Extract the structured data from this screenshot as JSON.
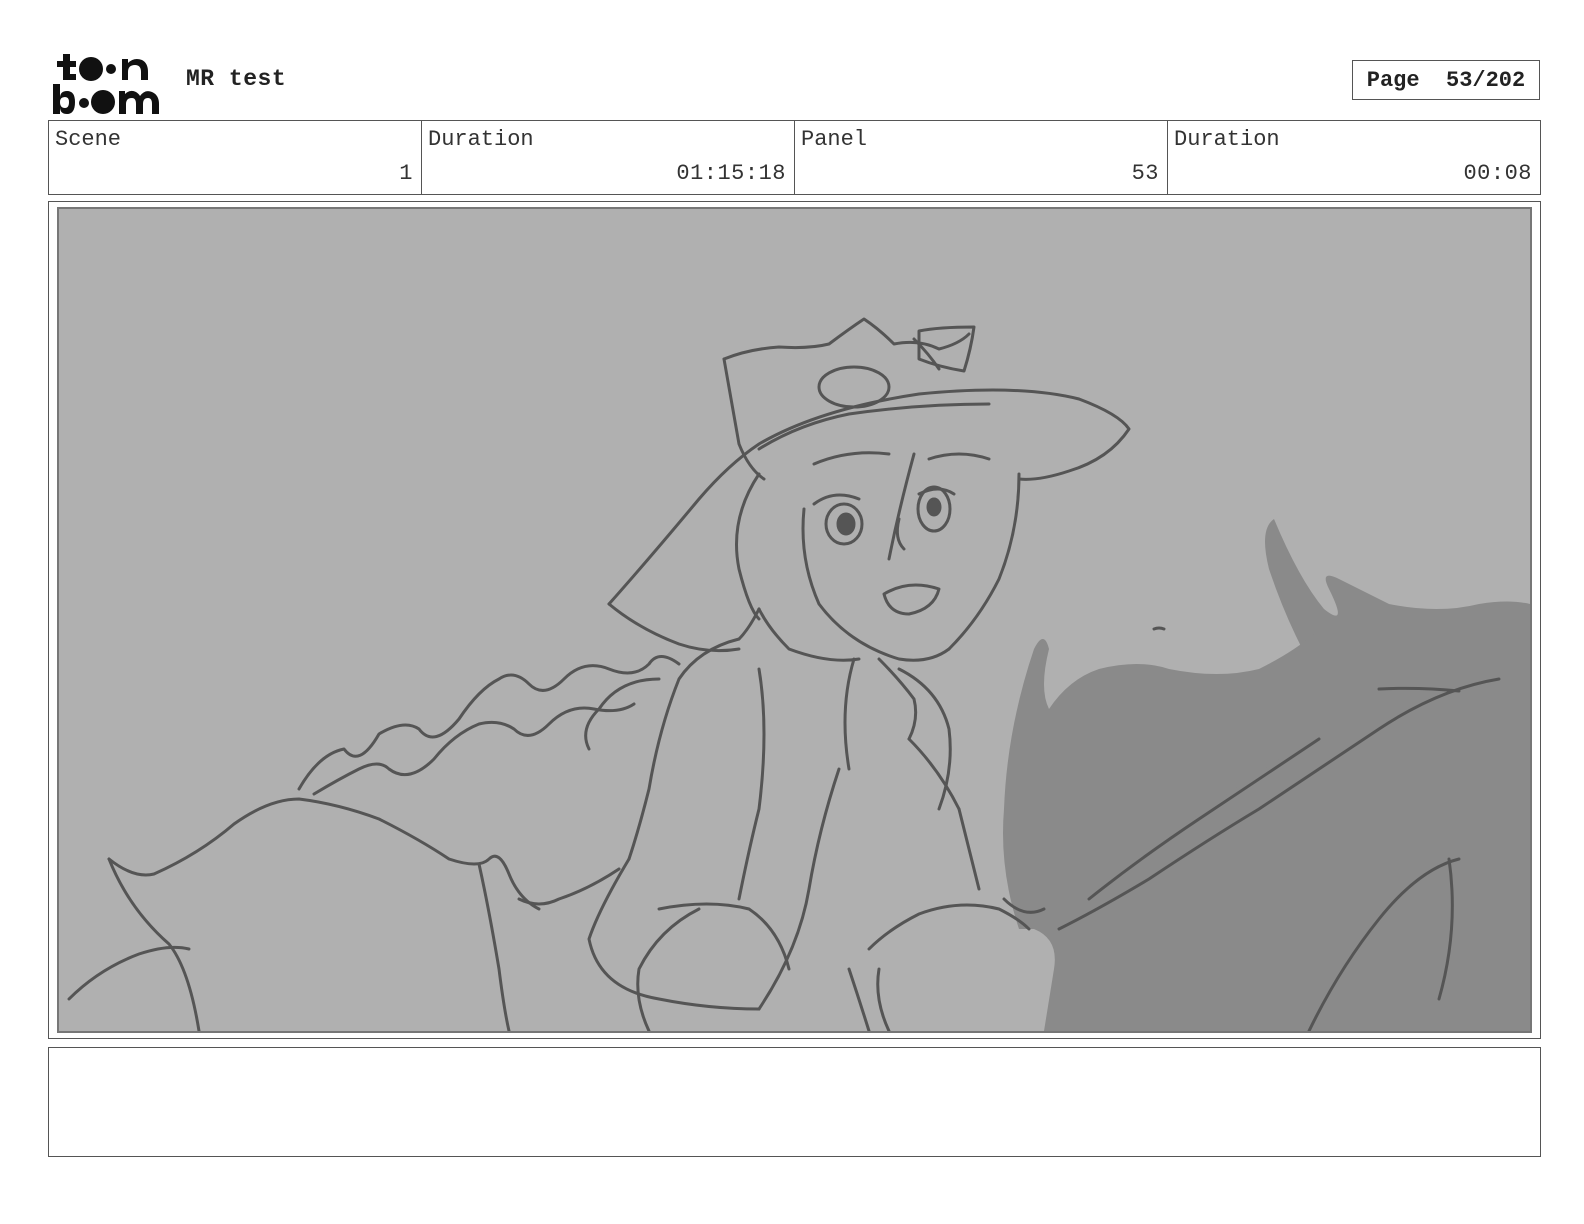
{
  "header": {
    "logo": {
      "line1": "toon",
      "line2": "boom",
      "icon": "toonboom-logo"
    },
    "project_title": "MR test",
    "page_label": "Page",
    "page_value": "53/202"
  },
  "info": {
    "scene_label": "Scene",
    "scene_value": "1",
    "scene_duration_label": "Duration",
    "scene_duration_value": "01:15:18",
    "panel_label": "Panel",
    "panel_value": "53",
    "panel_duration_label": "Duration",
    "panel_duration_value": "00:08"
  },
  "panel": {
    "background_color": "#b0b0b0",
    "shadow_color": "#8a8a8a",
    "line_color": "#555555"
  },
  "notes": {
    "text": ""
  }
}
